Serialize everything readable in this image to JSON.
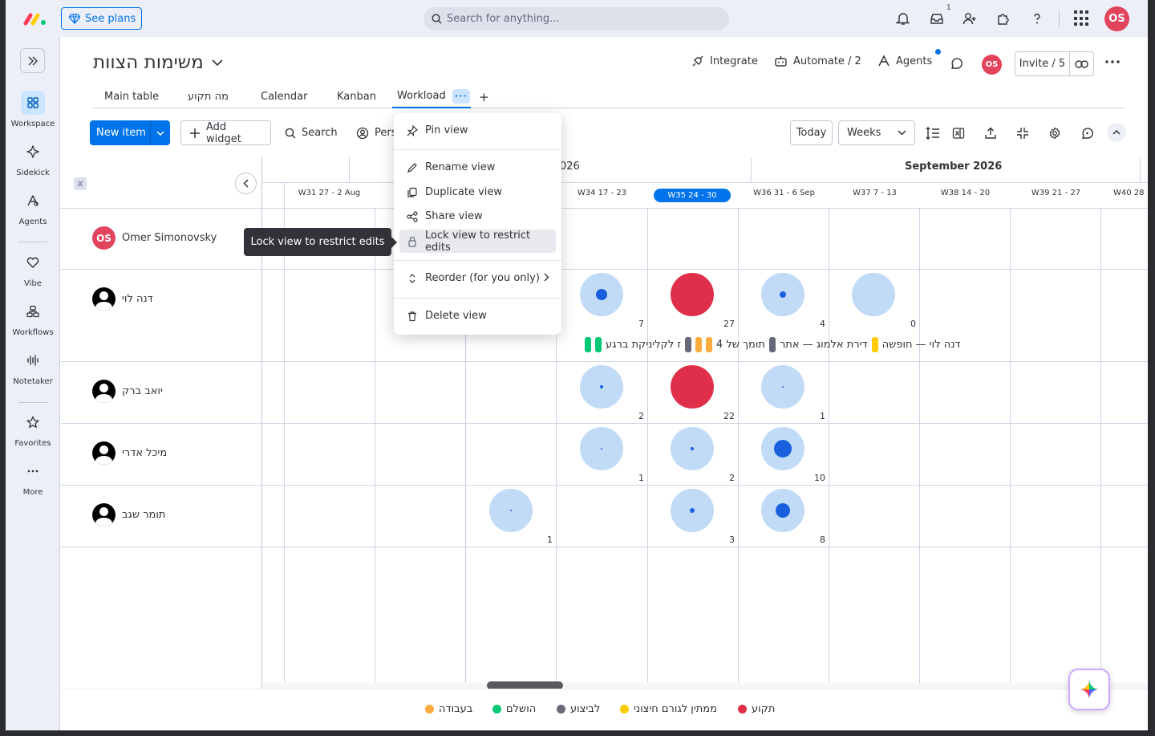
{
  "topbar": {
    "see_plans": "See plans",
    "search_placeholder": "Search for anything...",
    "inbox_badge": "1",
    "avatar": "OS"
  },
  "nav": {
    "items": [
      {
        "label": "Workspace",
        "icon": "grid-icon",
        "active": true
      },
      {
        "label": "Sidekick",
        "icon": "sparkle-icon"
      },
      {
        "label": "Agents",
        "icon": "agents-icon"
      },
      {
        "label": "Vibe",
        "icon": "heart-icon"
      },
      {
        "label": "Workflows",
        "icon": "workflow-icon"
      },
      {
        "label": "Notetaker",
        "icon": "waveform-icon"
      },
      {
        "label": "Favorites",
        "icon": "star-icon"
      },
      {
        "label": "More",
        "icon": "more-dots-icon"
      }
    ]
  },
  "board": {
    "title": "משימות הצוות",
    "integrate": "Integrate",
    "automate": "Automate / 2",
    "agents": "Agents",
    "avatar": "OS",
    "invite": "Invite / 5"
  },
  "tabs": [
    {
      "label": "Main table"
    },
    {
      "label": "מה תקוע"
    },
    {
      "label": "Calendar"
    },
    {
      "label": "Kanban"
    },
    {
      "label": "Workload",
      "active": true
    }
  ],
  "tabs_dots": "···",
  "tabs_add": "+",
  "toolbar": {
    "new_item": "New item",
    "add_widget": "Add widget",
    "search": "Search",
    "person": "Pers",
    "today": "Today",
    "weeks": "Weeks"
  },
  "timeline": {
    "months": [
      {
        "label": "026"
      },
      {
        "label": "September 2026"
      }
    ],
    "weeks": [
      {
        "label": "W31 27 - 2 Aug"
      },
      {
        "label": "W34 17 - 23"
      },
      {
        "label": "W35 24 - 30",
        "current": true
      },
      {
        "label": "W36 31 - 6 Sep"
      },
      {
        "label": "W37 7 - 13"
      },
      {
        "label": "W38 14 - 20"
      },
      {
        "label": "W39 21 - 27"
      },
      {
        "label": "W40 28"
      }
    ]
  },
  "people": [
    {
      "name": "Omer Simonovsky",
      "initials": "OS"
    },
    {
      "name": "דנה לוי"
    },
    {
      "name": "יואב ברק"
    },
    {
      "name": "מיכל אדרי"
    },
    {
      "name": "תומר שגב"
    }
  ],
  "workload": {
    "dana": [
      {
        "week": "W34",
        "count": "7",
        "load": 0.35
      },
      {
        "week": "W35",
        "count": "27",
        "load": 1.0,
        "overload": true
      },
      {
        "week": "W36",
        "count": "4",
        "load": 0.2
      },
      {
        "week": "W37",
        "count": "0",
        "load": 0.0
      }
    ],
    "yoav": [
      {
        "week": "W34",
        "count": "2",
        "load": 0.1
      },
      {
        "week": "W35",
        "count": "22",
        "load": 1.0,
        "overload": true
      },
      {
        "week": "W36",
        "count": "1",
        "load": 0.05
      }
    ],
    "michal": [
      {
        "week": "W34",
        "count": "1",
        "load": 0.05
      },
      {
        "week": "W35",
        "count": "2",
        "load": 0.1
      },
      {
        "week": "W36",
        "count": "10",
        "load": 0.55
      }
    ],
    "tomer": [
      {
        "week": "W33",
        "count": "1",
        "load": 0.05
      },
      {
        "week": "W35",
        "count": "3",
        "load": 0.15
      },
      {
        "week": "W36",
        "count": "8",
        "load": 0.45
      }
    ]
  },
  "task_strip": {
    "text1": "ז לקליניקת ברגע",
    "text2": "4 תומך של",
    "text3": "דירת אלמוג — אתר",
    "text4": "דנה לוי — חופשה"
  },
  "menu": {
    "pin": "Pin view",
    "rename": "Rename view",
    "duplicate": "Duplicate view",
    "share": "Share view",
    "lock": "Lock view to restrict edits",
    "reorder": "Reorder (for you only)",
    "delete": "Delete view"
  },
  "tooltip": "Lock view to restrict edits",
  "legend": [
    {
      "label": "בעבודה",
      "color": "#fdab3d"
    },
    {
      "label": "הושלם",
      "color": "#00c875"
    },
    {
      "label": "לביצוע",
      "color": "#676879"
    },
    {
      "label": "ממתין לגורם חיצוני",
      "color": "#ffcb00"
    },
    {
      "label": "תקוע",
      "color": "#df2f4a"
    }
  ]
}
